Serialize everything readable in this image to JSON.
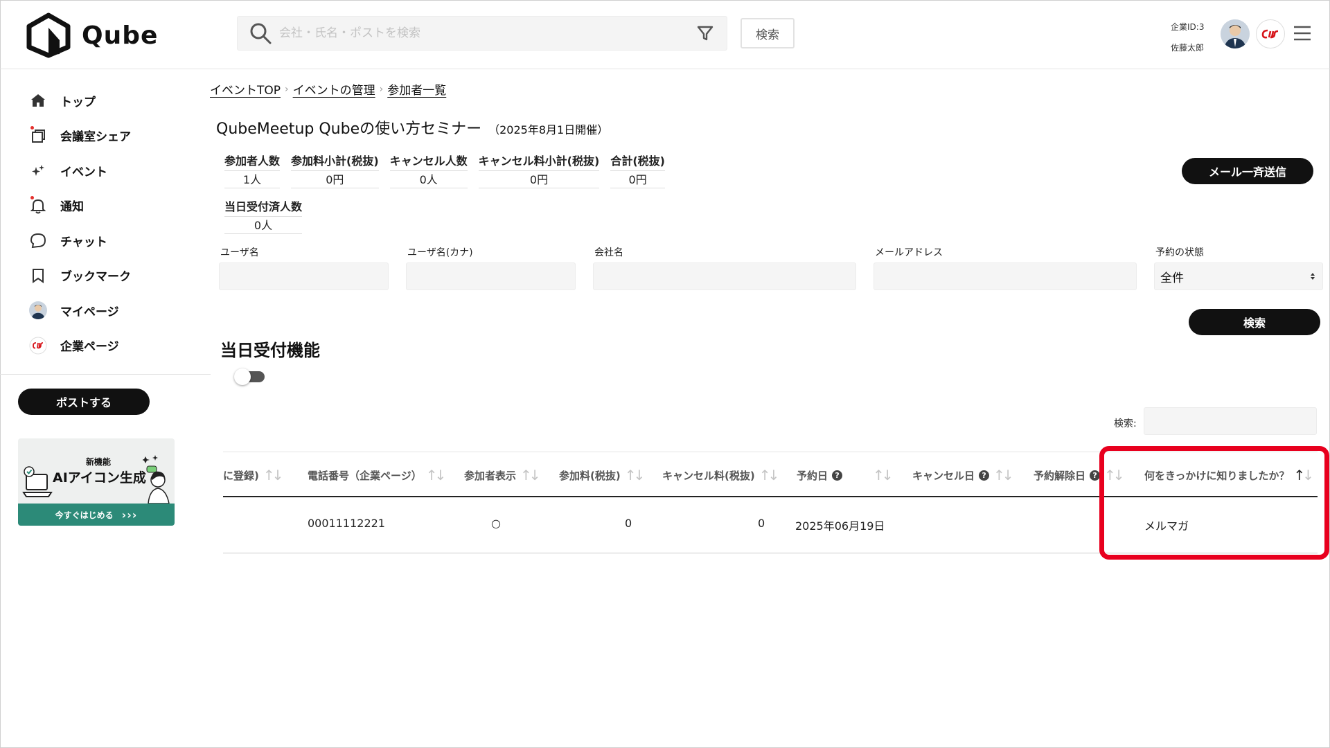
{
  "header": {
    "logo_text": "Qube",
    "search_placeholder": "会社・氏名・ポストを検索",
    "search_button": "検索",
    "company_id": "企業ID:3",
    "user_name": "佐藤太郎",
    "icons": [
      "search-icon",
      "filter-icon",
      "avatar",
      "company-logo",
      "menu-icon"
    ]
  },
  "sidebar": {
    "items": [
      {
        "label": "トップ",
        "icon": "home-icon"
      },
      {
        "label": "会議室シェア",
        "icon": "room-icon"
      },
      {
        "label": "イベント",
        "icon": "sparkle-icon"
      },
      {
        "label": "通知",
        "icon": "bell-icon"
      },
      {
        "label": "チャット",
        "icon": "chat-icon"
      },
      {
        "label": "ブックマーク",
        "icon": "bookmark-icon"
      },
      {
        "label": "マイページ",
        "icon": "avatar"
      },
      {
        "label": "企業ページ",
        "icon": "company-logo"
      }
    ],
    "post_button": "ポストする",
    "banner": {
      "small": "新機能",
      "main": "AIアイコン生成",
      "cta": "今すぐはじめる",
      "cta_arrows": "›››"
    }
  },
  "breadcrumb": [
    "イベントTOP",
    "イベントの管理",
    "参加者一覧"
  ],
  "page": {
    "title": "QubeMeetup Qubeの使い方セミナー",
    "date": "（2025年8月1日開催）"
  },
  "stats": [
    {
      "label": "参加者人数",
      "value": "1人"
    },
    {
      "label": "参加料小計(税抜)",
      "value": "0円"
    },
    {
      "label": "キャンセル人数",
      "value": "0人"
    },
    {
      "label": "キャンセル料小計(税抜)",
      "value": "0円"
    },
    {
      "label": "合計(税抜)",
      "value": "0円"
    }
  ],
  "stats_day": {
    "label": "当日受付済人数",
    "value": "0人"
  },
  "mail_button": "メール一斉送信",
  "filters": {
    "user_name": "ユーザ名",
    "user_name_kana": "ユーザ名(カナ)",
    "company": "会社名",
    "email": "メールアドレス",
    "status": "予約の状態",
    "status_value": "全件",
    "search_button": "検索"
  },
  "reception": {
    "title": "当日受付機能",
    "enabled": false
  },
  "table": {
    "search_label": "検索:",
    "columns": [
      "に登録)",
      "電話番号（企業ページ）",
      "参加者表示",
      "参加料(税抜)",
      "キャンセル料(税抜)",
      "予約日",
      "キャンセル日",
      "予約解除日",
      "何をきっかけに知りましたか？"
    ],
    "rows": [
      [
        "",
        "00011112221",
        "○",
        "0",
        "0",
        "2025年06月19日",
        "",
        "",
        "メルマガ"
      ]
    ]
  },
  "colors": {
    "accent": "#111111",
    "highlight": "#e8001e",
    "banner_cta": "#2c8a78"
  }
}
